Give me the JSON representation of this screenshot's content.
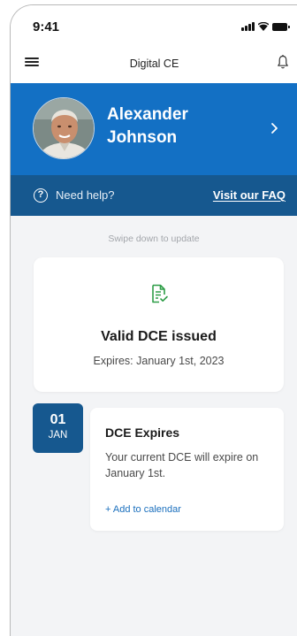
{
  "status_bar": {
    "time": "9:41",
    "icons": [
      "signal-icon",
      "wifi-icon",
      "battery-icon"
    ]
  },
  "navbar": {
    "title": "Digital CE",
    "left_icon": "menu-icon",
    "right_icon": "bell-icon"
  },
  "profile": {
    "name": "Alexander Johnson",
    "avatar": "avatar",
    "chevron": "chevron-right-icon"
  },
  "help": {
    "text": "Need help?",
    "link": "Visit our FAQ",
    "icon": "help-icon"
  },
  "swipe_hint": "Swipe down to update",
  "dce_status": {
    "icon": "document-check-icon",
    "title": "Valid DCE issued",
    "expiry": "Expires: January 1st, 2023"
  },
  "event": {
    "day": "01",
    "month": "JAN",
    "title": "DCE Expires",
    "description": "Your current DCE will expire on January 1st.",
    "action": "+ Add to calendar"
  },
  "colors": {
    "primary": "#1370c4",
    "help_bar": "#16588f",
    "background": "#f3f4f6",
    "success_icon": "#2f9e48",
    "link": "#1a6fbd"
  }
}
